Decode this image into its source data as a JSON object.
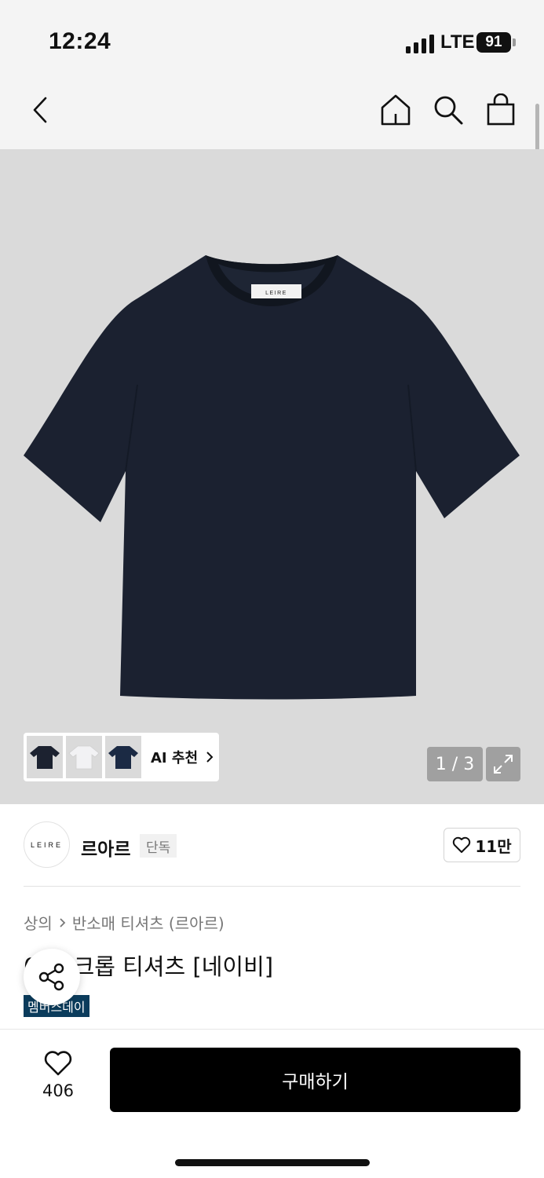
{
  "status_bar": {
    "time": "12:24",
    "network": "LTE",
    "battery": "91"
  },
  "nav": {
    "back_icon": "chevron-left-icon",
    "home_icon": "home-icon",
    "search_icon": "search-icon",
    "cart_icon": "shopping-bag-icon"
  },
  "gallery": {
    "tag_label": "LEIRE",
    "ai_recommend_label": "AI 추천",
    "page_counter": "1 / 3",
    "thumbnail_colors": [
      "#1c2230",
      "#f2f2f4",
      "#1b2a44"
    ]
  },
  "brand": {
    "logo_text": "LEIRE",
    "name": "르아르",
    "badge": "단독",
    "likes": "11만"
  },
  "product": {
    "breadcrumb": [
      "상의",
      "반소매 티셔츠 (르아르)"
    ],
    "title": "0   설 크롭 티셔츠 [네이비]",
    "event_tag": "멤버스데이",
    "shirt_color": "#1b2130"
  },
  "bottom": {
    "wish_count": "406",
    "buy_label": "구매하기"
  },
  "colors": {
    "accent_tag": "#0b3c5c",
    "buy_button": "#000000"
  }
}
